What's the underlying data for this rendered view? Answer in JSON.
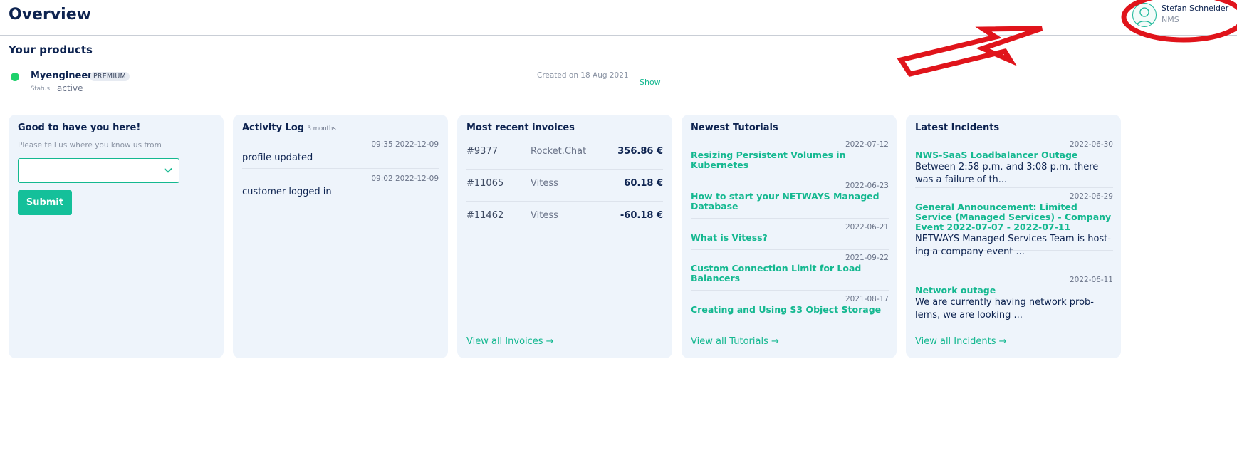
{
  "header": {
    "title": "Overview"
  },
  "user": {
    "name": "Stefan Schneider",
    "org": "NMS",
    "avatar_icon": "user-avatar-icon"
  },
  "products": {
    "title": "Your products",
    "items": [
      {
        "name": "Myengineer",
        "badge": "PREMIUM",
        "status_label": "Status",
        "status_value": "active",
        "created": "Created on 18 Aug 2021",
        "show": "Show",
        "status_color": "#1ed16b"
      }
    ]
  },
  "welcome": {
    "title": "Good to have you here!",
    "hint": "Please tell us where you know us from",
    "select_value": "",
    "submit": "Submit"
  },
  "activity": {
    "title": "Activity Log",
    "range": "3 months",
    "items": [
      {
        "time": "09:35 2022-12-09",
        "text": "profile updated"
      },
      {
        "time": "09:02 2022-12-09",
        "text": "customer logged in"
      }
    ]
  },
  "invoices": {
    "title": "Most recent invoices",
    "rows": [
      {
        "number": "#9377",
        "product": "Rocket.Chat",
        "amount": "356.86 €"
      },
      {
        "number": "#11065",
        "product": "Vitess",
        "amount": "60.18 €"
      },
      {
        "number": "#11462",
        "product": "Vitess",
        "amount": "-60.18 €"
      }
    ],
    "view_all": "View all Invoices →"
  },
  "tutorials": {
    "title": "Newest Tutorials",
    "items": [
      {
        "date": "2022-07-12",
        "title": "Resizing Persistent Volumes in Kubernetes"
      },
      {
        "date": "2022-06-23",
        "title": "How to start your NETWAYS Managed Database"
      },
      {
        "date": "2022-06-21",
        "title": "What is Vitess?"
      },
      {
        "date": "2021-09-22",
        "title": "Custom Connection Limit for Load Balancers"
      },
      {
        "date": "2021-08-17",
        "title": "Creating and Using S3 Object Storage"
      }
    ],
    "view_all": "View all Tutorials →"
  },
  "incidents": {
    "title": "Latest Incidents",
    "items": [
      {
        "date": "2022-06-30",
        "title": "NWS-SaaS Loadbalancer Outage",
        "text": "Between 2:58 p.m. and 3:08 p.m. there was a failure of th..."
      },
      {
        "date": "2022-06-29",
        "title": "General Announcement: Limited Service (Managed Services) - Company Event 2022-07-07 - 2022-07-11",
        "text": "NETWAYS Managed Services Team is host- ing a company event ..."
      },
      {
        "date": "2022-06-11",
        "title": "Network outage",
        "text": "We are currently having network prob- lems, we are looking ..."
      }
    ],
    "view_all": "View all Incidents →"
  },
  "colors": {
    "accent": "#14b890",
    "navy": "#0d2350",
    "card_bg": "#eef4fb",
    "annotation": "#e0141b"
  }
}
